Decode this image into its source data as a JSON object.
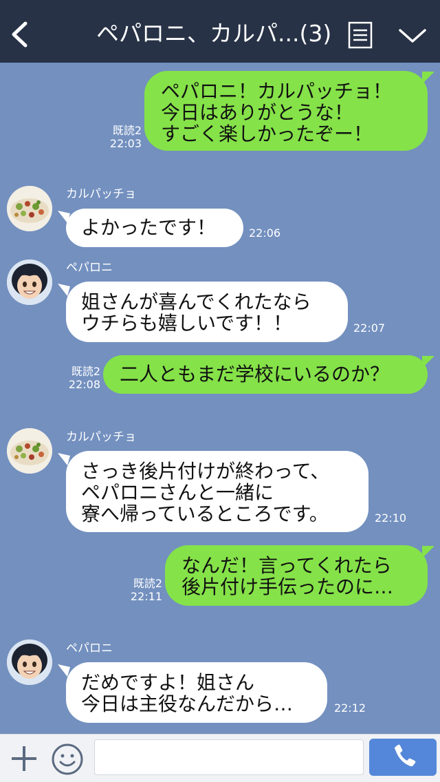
{
  "header": {
    "title": "ペパロニ、カルパ...(3)",
    "back_icon": "chevron-left-icon",
    "menu_icon": "list-icon",
    "expand_icon": "chevron-down-icon"
  },
  "messages": [
    {
      "side": "out",
      "text": "ペパロニ！カルパッチョ！\n今日はありがとうな！\nすごく楽しかったぞー！",
      "read": "既読2",
      "time": "22:03"
    },
    {
      "side": "in",
      "sender": "カルパッチョ",
      "text": "よかったです！",
      "time": "22:06"
    },
    {
      "side": "in",
      "sender": "ペパロニ",
      "text": "姐さんが喜んでくれたなら\nウチらも嬉しいです！！",
      "time": "22:07"
    },
    {
      "side": "out",
      "text": "二人ともまだ学校にいるのか？",
      "read": "既読2",
      "time": "22:08"
    },
    {
      "side": "in",
      "sender": "カルパッチョ",
      "text": "さっき後片付けが終わって、\nペパロニさんと一緒に\n寮へ帰っているところです。",
      "time": "22:10"
    },
    {
      "side": "out",
      "text": "なんだ！言ってくれたら\n後片付け手伝ったのに…",
      "read": "既読2",
      "time": "22:11"
    },
    {
      "side": "in",
      "sender": "ペパロニ",
      "text": "だめですよ！姐さん\n今日は主役なんだから…",
      "time": "22:12"
    }
  ],
  "input": {
    "value": "",
    "placeholder": "",
    "plus_icon": "plus-icon",
    "emoji_icon": "emoji-icon",
    "call_icon": "phone-icon"
  },
  "colors": {
    "header_bg": "#273246",
    "chat_bg": "#7390bf",
    "outgoing_bubble": "#85e249",
    "incoming_bubble": "#ffffff",
    "call_button": "#5487d9"
  }
}
